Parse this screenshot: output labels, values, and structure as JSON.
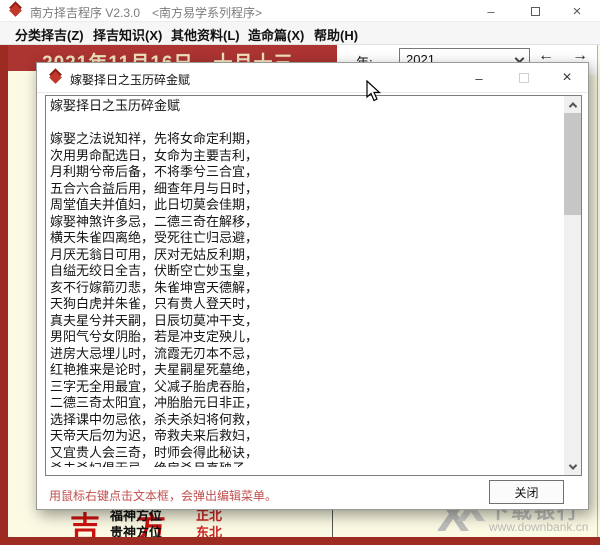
{
  "app": {
    "title": "南方择吉程序 V2.3.0　<南方易学系列程序>",
    "window_controls": {
      "minimize": "–",
      "close": "×"
    }
  },
  "menu": {
    "items": [
      "分类择吉(Z)",
      "择吉知识(X)",
      "其他资料(L)",
      "造命篇(X)",
      "帮助(H)"
    ]
  },
  "toolbar": {
    "date_banner": "2021年11月16日　十月十三",
    "year_label": "年:",
    "year_value": "2021",
    "prev_arrow": "←",
    "next_arrow": "→"
  },
  "dialog": {
    "title": "嫁娶择日之玉历碎金赋",
    "window_controls": {
      "minimize": "–",
      "close": "×"
    },
    "text": "嫁娶择日之玉历碎金赋\n\n嫁娶之法说知祥，先将女命定利期，\n次用男命配选日，女命为主要吉利，\n月利期兮帝后备，不将季兮三合宜，\n五合六合益后用，细查年月与日时，\n周堂值夫并值妇，此日切莫会佳期，\n嫁娶神煞许多忌，二德三奇在解移，\n横天朱雀四离绝，受死往亡归忌避，\n月厌无翁日可用，厌对无姑反利期，\n自缢无绞日全吉，伏断空亡妙玉皇，\n亥不行嫁箭刃悲，朱雀坤宫天德解，\n天狗白虎并朱雀，只有贵人登天时，\n真夫星兮并天嗣，日辰切莫冲干支，\n男阳气兮女阴胎，若是冲支定殃儿，\n进房大忌埋儿时，流霞无刃本不忌，\n红艳推来是论时，夫星嗣星死墓绝，\n三字无全用最宜，父减子胎虎吞胎，\n二德三奇太阳宜，冲胎胎元日非正，\n选择课中勿忌依，杀夫杀妇将何救，\n天帝天后勿为迟，帝救夫来后救妇，\n又宜贵人会三奇，时师会得此秘诀，\n杀夫杀妇俱无忌，绝房杀月真殃子",
    "hint": "用鼠标右键点击文本框，会弹出编辑菜单。",
    "close_label": "关闭"
  },
  "panel": {
    "big_label": "吉方",
    "rows": [
      {
        "label": "福神方位",
        "value": "正北"
      },
      {
        "label": "贵神方位",
        "value": "东北"
      }
    ]
  },
  "watermark": {
    "name": "下载银行",
    "url": "www.downbank.cn"
  },
  "colors": {
    "banner_red": "#ac3431",
    "frame_red": "#9e2b22",
    "background_yellow": "#fbfae3",
    "hint_red": "#c0504d",
    "value_red": "#cc2222",
    "accent_red": "#c0392b"
  }
}
